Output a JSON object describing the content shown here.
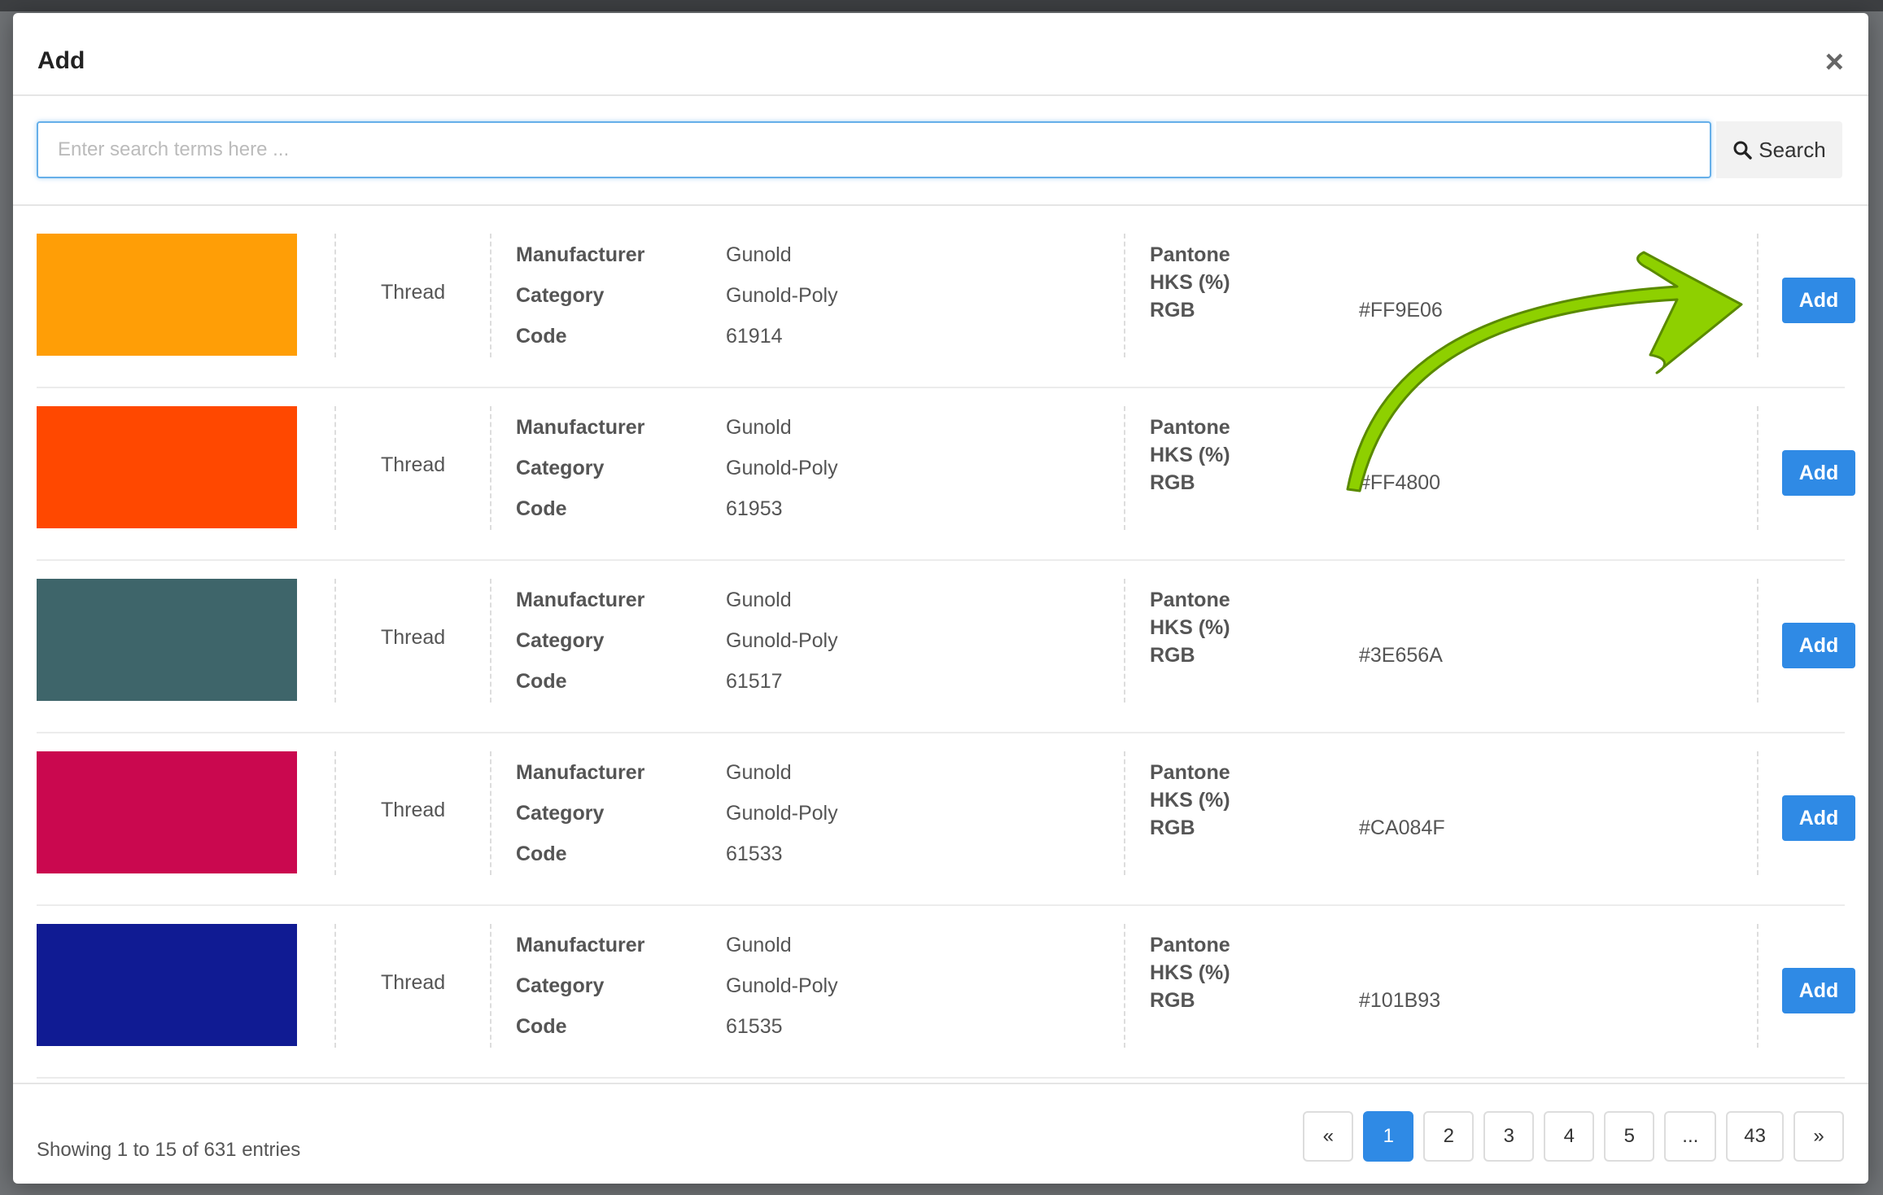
{
  "modal": {
    "title": "Add",
    "close_label": "×"
  },
  "search": {
    "placeholder": "Enter search terms here ...",
    "button_label": "Search",
    "value": ""
  },
  "labels": {
    "manufacturer": "Manufacturer",
    "category": "Category",
    "code": "Code",
    "pantone": "Pantone",
    "hks": "HKS (%)",
    "rgb": "RGB",
    "add_button": "Add"
  },
  "rows": [
    {
      "swatch_color": "#FF9E06",
      "type": "Thread",
      "manufacturer": "Gunold",
      "category": "Gunold-Poly",
      "code": "61914",
      "pantone": "",
      "hks": "",
      "rgb": "#FF9E06"
    },
    {
      "swatch_color": "#FF4800",
      "type": "Thread",
      "manufacturer": "Gunold",
      "category": "Gunold-Poly",
      "code": "61953",
      "pantone": "",
      "hks": "",
      "rgb": "#FF4800"
    },
    {
      "swatch_color": "#3E656A",
      "type": "Thread",
      "manufacturer": "Gunold",
      "category": "Gunold-Poly",
      "code": "61517",
      "pantone": "",
      "hks": "",
      "rgb": "#3E656A"
    },
    {
      "swatch_color": "#CA084F",
      "type": "Thread",
      "manufacturer": "Gunold",
      "category": "Gunold-Poly",
      "code": "61533",
      "pantone": "",
      "hks": "",
      "rgb": "#CA084F"
    },
    {
      "swatch_color": "#101B93",
      "type": "Thread",
      "manufacturer": "Gunold",
      "category": "Gunold-Poly",
      "code": "61535",
      "pantone": "",
      "hks": "",
      "rgb": "#101B93"
    }
  ],
  "footer": {
    "showing_text": "Showing 1 to 15 of 631 entries"
  },
  "pagination": {
    "prev": "«",
    "pages": [
      "1",
      "2",
      "3",
      "4",
      "5",
      "...",
      "43"
    ],
    "active": "1",
    "next": "»"
  },
  "colors": {
    "accent": "#2f8ae5",
    "annotation_arrow": "#8ed000"
  },
  "icons": [
    "close-icon",
    "search-icon",
    "annotation-arrow"
  ]
}
